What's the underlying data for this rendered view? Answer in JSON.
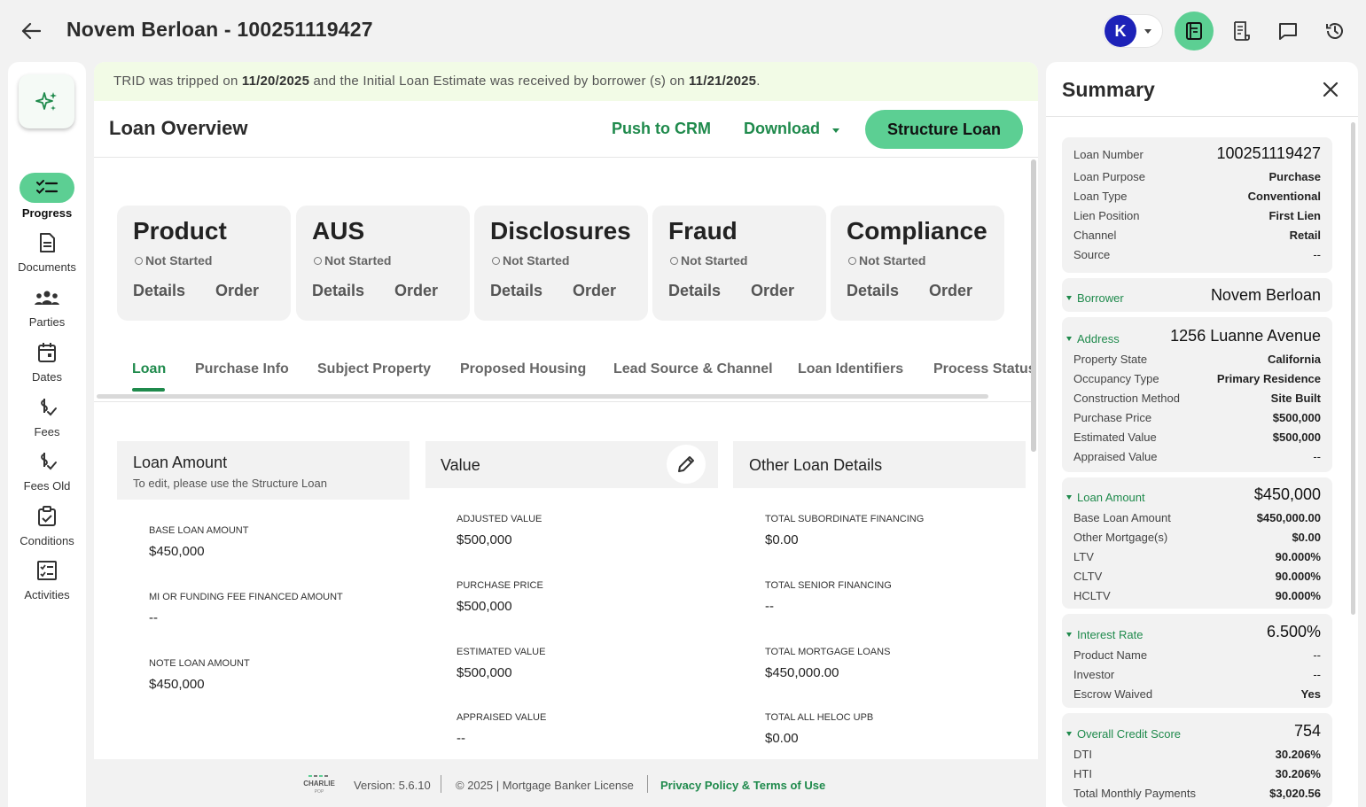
{
  "header": {
    "title": "Novem Berloan - 100251119427",
    "avatar_initial": "K",
    "icons": [
      "back-arrow-icon",
      "loan-file-icon",
      "receipt-icon",
      "chat-icon",
      "history-icon"
    ],
    "accent": "#5ccf93",
    "avatar_color": "#1d22b8"
  },
  "nav": {
    "items": [
      {
        "label": "Progress",
        "icon": "checklist-icon",
        "active": true
      },
      {
        "label": "Documents",
        "icon": "document-icon"
      },
      {
        "label": "Parties",
        "icon": "people-icon"
      },
      {
        "label": "Dates",
        "icon": "calendar-icon"
      },
      {
        "label": "Fees",
        "icon": "dollar-check-icon"
      },
      {
        "label": "Fees Old",
        "icon": "dollar-check-icon"
      },
      {
        "label": "Conditions",
        "icon": "clipboard-check-icon"
      },
      {
        "label": "Activities",
        "icon": "activity-checkbox-icon"
      }
    ]
  },
  "banner": {
    "text1": "TRID was tripped on ",
    "date1": "11/20/2025",
    "text2": " and the Initial Loan Estimate was received by borrower (s) on ",
    "date2": "11/21/2025",
    "text3": "."
  },
  "overview": {
    "title": "Loan Overview",
    "push_crm": "Push to CRM",
    "download": "Download",
    "structure": "Structure Loan"
  },
  "status_cards": [
    {
      "title": "Product",
      "status": "Not Started",
      "details": "Details",
      "order": "Order"
    },
    {
      "title": "AUS",
      "status": "Not Started",
      "details": "Details",
      "order": "Order"
    },
    {
      "title": "Disclosures",
      "status": "Not Started",
      "details": "Details",
      "order": "Order"
    },
    {
      "title": "Fraud",
      "status": "Not Started",
      "details": "Details",
      "order": "Order"
    },
    {
      "title": "Compliance",
      "status": "Not Started",
      "details": "Details",
      "order": "Order"
    }
  ],
  "tabs": [
    "Loan",
    "Purchase Info",
    "Subject Property",
    "Proposed Housing",
    "Lead Source & Channel",
    "Loan Identifiers",
    "Process Status"
  ],
  "sections": {
    "loan_amount": {
      "title": "Loan Amount",
      "subtitle": "To edit, please use the Structure Loan",
      "fields": [
        {
          "label": "BASE LOAN AMOUNT",
          "value": "$450,000"
        },
        {
          "label": "MI OR FUNDING FEE FINANCED AMOUNT",
          "value": "--"
        },
        {
          "label": "NOTE LOAN AMOUNT",
          "value": "$450,000"
        }
      ]
    },
    "value": {
      "title": "Value",
      "fields": [
        {
          "label": "ADJUSTED VALUE",
          "value": "$500,000"
        },
        {
          "label": "PURCHASE PRICE",
          "value": "$500,000"
        },
        {
          "label": "ESTIMATED VALUE",
          "value": "$500,000"
        },
        {
          "label": "APPRAISED VALUE",
          "value": "--"
        }
      ]
    },
    "other": {
      "title": "Other Loan Details",
      "fields": [
        {
          "label": "TOTAL SUBORDINATE FINANCING",
          "value": "$0.00"
        },
        {
          "label": "TOTAL SENIOR FINANCING",
          "value": "--"
        },
        {
          "label": "TOTAL MORTGAGE LOANS",
          "value": "$450,000.00"
        },
        {
          "label": "TOTAL ALL HELOC UPB",
          "value": "$0.00"
        }
      ]
    }
  },
  "footer": {
    "logo_text": "CHARLIE",
    "logo_sub": "POP",
    "version": "Version: 5.6.10",
    "copyright": "© 2025 | Mortgage Banker License",
    "privacy": "Privacy Policy & Terms of Use"
  },
  "summary": {
    "title": "Summary",
    "loan": {
      "number_label": "Loan Number",
      "number_value": "100251119427",
      "rows": [
        {
          "k": "Loan Purpose",
          "v": "Purchase"
        },
        {
          "k": "Loan Type",
          "v": "Conventional"
        },
        {
          "k": "Lien Position",
          "v": "First Lien"
        },
        {
          "k": "Channel",
          "v": "Retail"
        },
        {
          "k": "Source",
          "v": "--"
        }
      ]
    },
    "borrower": {
      "label": "Borrower",
      "value": "Novem Berloan"
    },
    "address": {
      "label": "Address",
      "value": "1256 Luanne Avenue",
      "rows": [
        {
          "k": "Property State",
          "v": "California"
        },
        {
          "k": "Occupancy Type",
          "v": "Primary Residence"
        },
        {
          "k": "Construction Method",
          "v": "Site Built"
        },
        {
          "k": "Purchase Price",
          "v": "$500,000"
        },
        {
          "k": "Estimated Value",
          "v": "$500,000"
        },
        {
          "k": "Appraised Value",
          "v": "--"
        }
      ]
    },
    "loan_amount": {
      "label": "Loan Amount",
      "value": "$450,000",
      "rows": [
        {
          "k": "Base Loan Amount",
          "v": "$450,000.00"
        },
        {
          "k": "Other Mortgage(s)",
          "v": "$0.00"
        },
        {
          "k": "LTV",
          "v": "90.000%"
        },
        {
          "k": "CLTV",
          "v": "90.000%"
        },
        {
          "k": "HCLTV",
          "v": "90.000%"
        }
      ]
    },
    "interest": {
      "label": "Interest Rate",
      "value": "6.500%",
      "rows": [
        {
          "k": "Product Name",
          "v": "--"
        },
        {
          "k": "Investor",
          "v": "--"
        },
        {
          "k": "Escrow Waived",
          "v": "Yes"
        }
      ]
    },
    "credit": {
      "label": "Overall Credit Score",
      "value": "754",
      "rows": [
        {
          "k": "DTI",
          "v": "30.206%"
        },
        {
          "k": "HTI",
          "v": "30.206%"
        },
        {
          "k": "Total Monthly Payments",
          "v": "$3,020.56"
        }
      ]
    }
  }
}
